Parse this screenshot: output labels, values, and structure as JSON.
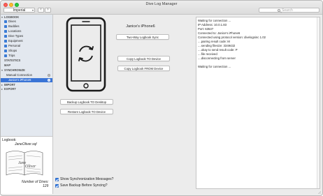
{
  "window": {
    "title": "Dive Log Manager"
  },
  "toolbar": {
    "units_selected": "Imperial",
    "back_glyph": "‹",
    "forward_glyph": "›",
    "search_placeholder": "Search"
  },
  "sidebar": {
    "logbook_header": "LOGBOOK",
    "logbook_items": [
      {
        "label": "Dives",
        "icon": "dives-icon",
        "color": "#3a7bd5"
      },
      {
        "label": "Buddies",
        "icon": "buddies-icon",
        "color": "#3a7bd5"
      },
      {
        "label": "Locations",
        "icon": "locations-icon",
        "color": "#3a7bd5"
      },
      {
        "label": "Dive Types",
        "icon": "dive-types-icon",
        "color": "#3a7bd5"
      },
      {
        "label": "Equipment",
        "icon": "equipment-icon",
        "color": "#3a7bd5"
      },
      {
        "label": "Personal",
        "icon": "personal-icon",
        "color": "#3a7bd5"
      },
      {
        "label": "Shops",
        "icon": "shops-icon",
        "color": "#3a7bd5"
      },
      {
        "label": "Trips",
        "icon": "trips-icon",
        "color": "#3a7bd5"
      }
    ],
    "statistics_label": "STATISTICS",
    "map_label": "MAP",
    "synchronize_header": "SYNCHRONIZE",
    "sync_items": [
      {
        "label": "Manual Connection",
        "badge": "0"
      },
      {
        "label": "Janice's iPhone6",
        "badge": "0"
      }
    ],
    "import_label": "IMPORT",
    "export_label": "EXPORT"
  },
  "logbook_panel": {
    "label": "Logbook:",
    "filename": "JaneOliver.sql",
    "book_text_1": "Jane",
    "book_text_2": "Oliver",
    "dives_label": "Number of Dives:",
    "dives_count": "129"
  },
  "sync": {
    "device_name": "Janice's iPhone6",
    "two_way_button": "Two-Way Logbook Sync",
    "copy_to_device_button": "Copy Logbook TO Device",
    "copy_from_device_button": "Copy Logbook FROM Device",
    "backup_button": "Backup Logbook TO Desktop",
    "restore_button": "Restore Logbook TO Device",
    "show_messages_label": "Show Synchronization Messages?",
    "show_messages_checked": true,
    "save_backup_label": "Save Backup Before Syncing?",
    "save_backup_checked": true
  },
  "log": {
    "lines": [
      "Waiting for connection ...",
      "IP Address: 10.0.1.83",
      "Port: 63537",
      "Connected to: Janice's iPhone6",
      "Connected using protocol version: divelogsinc 1.02",
      "....pairing result code: M",
      "....sending filesize: 3349432",
      "....okay to send result code: P",
      "....file received",
      "....disconnecting from server",
      "",
      "Waiting for connection ..."
    ]
  },
  "colors": {
    "selection": "#3a74d6",
    "sidebar_bg": "#e3e8ef",
    "checkbox": "#3a80e8"
  }
}
